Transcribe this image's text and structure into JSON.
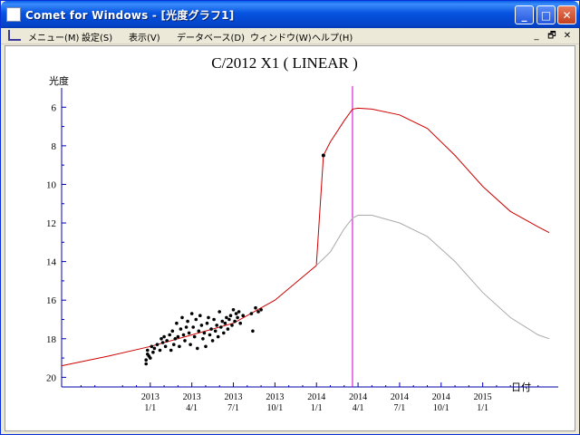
{
  "window": {
    "title": "Comet for Windows - [光度グラフ1]",
    "buttons": {
      "minimize": "_",
      "maximize": "□",
      "close": "✕"
    }
  },
  "menubar": {
    "items": [
      "メニュー(M)",
      "設定(S)",
      "表示(V)",
      "データベース(D)",
      "ウィンドウ(W)",
      "ヘルプ(H)"
    ],
    "mdi_buttons": [
      "_",
      "🗗",
      "✕"
    ]
  },
  "colors": {
    "accent": "#0054e3",
    "observed_curve": "#cc0000",
    "secondary_curve": "#aaaaaa",
    "perihelion_line": "#cc00cc",
    "axis": "#0000aa"
  },
  "chart_data": {
    "type": "scatter",
    "title": "C/2012 X1 ( LINEAR )",
    "ylabel": "光度",
    "xlabel": "日付",
    "y_inverted": true,
    "ylim": [
      20.5,
      5
    ],
    "y_ticks": [
      6,
      8,
      10,
      12,
      14,
      16,
      18,
      20
    ],
    "x_ticks": [
      {
        "year": "2013",
        "md": "1/1"
      },
      {
        "year": "2013",
        "md": "4/1"
      },
      {
        "year": "2013",
        "md": "7/1"
      },
      {
        "year": "2013",
        "md": "10/1"
      },
      {
        "year": "2014",
        "md": "1/1"
      },
      {
        "year": "2014",
        "md": "4/1"
      },
      {
        "year": "2014",
        "md": "7/1"
      },
      {
        "year": "2014",
        "md": "10/1"
      },
      {
        "year": "2015",
        "md": "1/1"
      }
    ],
    "xlim_months": [
      -6.4,
      28.8
    ],
    "perihelion_month": 14.6,
    "series": [
      {
        "kind": "line",
        "points": [
          [
            -6.4,
            19.4
          ],
          [
            -3,
            18.9
          ],
          [
            0,
            18.4
          ],
          [
            3,
            17.8
          ],
          [
            6,
            17.2
          ],
          [
            9,
            16.0
          ],
          [
            12,
            14.2
          ],
          [
            12.0,
            14.1
          ],
          [
            12.5,
            8.5
          ],
          [
            13,
            7.8
          ],
          [
            14,
            6.7
          ],
          [
            14.6,
            6.1
          ],
          [
            15,
            6.05
          ],
          [
            16,
            6.1
          ],
          [
            18,
            6.4
          ],
          [
            20,
            7.1
          ],
          [
            22,
            8.5
          ],
          [
            24,
            10.1
          ],
          [
            26,
            11.4
          ],
          [
            28,
            12.2
          ],
          [
            28.8,
            12.5
          ]
        ]
      },
      {
        "kind": "line",
        "points": [
          [
            12,
            14.2
          ],
          [
            13,
            13.5
          ],
          [
            14,
            12.3
          ],
          [
            14.6,
            11.75
          ],
          [
            15,
            11.6
          ],
          [
            16,
            11.6
          ],
          [
            18,
            12.0
          ],
          [
            20,
            12.7
          ],
          [
            22,
            14.0
          ],
          [
            24,
            15.6
          ],
          [
            26,
            16.9
          ],
          [
            28,
            17.8
          ],
          [
            28.8,
            18.0
          ]
        ]
      }
    ],
    "observations": [
      [
        -0.3,
        19.3
      ],
      [
        -0.3,
        19.1
      ],
      [
        -0.2,
        18.8
      ],
      [
        -0.2,
        18.6
      ],
      [
        -0.1,
        18.9
      ],
      [
        0.0,
        19.0
      ],
      [
        0.1,
        18.4
      ],
      [
        0.2,
        18.7
      ],
      [
        0.3,
        18.5
      ],
      [
        0.5,
        18.3
      ],
      [
        0.7,
        18.6
      ],
      [
        0.8,
        18.0
      ],
      [
        0.9,
        18.2
      ],
      [
        1.0,
        17.9
      ],
      [
        1.1,
        18.4
      ],
      [
        1.2,
        18.1
      ],
      [
        1.4,
        17.8
      ],
      [
        1.5,
        18.6
      ],
      [
        1.6,
        17.6
      ],
      [
        1.7,
        18.3
      ],
      [
        1.8,
        18.0
      ],
      [
        1.9,
        17.2
      ],
      [
        2.0,
        17.9
      ],
      [
        2.1,
        18.4
      ],
      [
        2.2,
        17.5
      ],
      [
        2.3,
        16.9
      ],
      [
        2.4,
        17.8
      ],
      [
        2.5,
        18.1
      ],
      [
        2.6,
        17.4
      ],
      [
        2.7,
        17.1
      ],
      [
        2.8,
        17.7
      ],
      [
        2.9,
        18.3
      ],
      [
        3.0,
        16.7
      ],
      [
        3.1,
        17.4
      ],
      [
        3.2,
        17.9
      ],
      [
        3.3,
        17.0
      ],
      [
        3.4,
        18.5
      ],
      [
        3.5,
        17.6
      ],
      [
        3.6,
        16.8
      ],
      [
        3.7,
        17.3
      ],
      [
        3.8,
        18.0
      ],
      [
        3.9,
        17.7
      ],
      [
        4.0,
        18.4
      ],
      [
        4.1,
        17.2
      ],
      [
        4.2,
        16.9
      ],
      [
        4.3,
        17.8
      ],
      [
        4.4,
        17.5
      ],
      [
        4.5,
        18.1
      ],
      [
        4.6,
        17.0
      ],
      [
        4.7,
        17.6
      ],
      [
        4.8,
        17.3
      ],
      [
        4.9,
        17.9
      ],
      [
        5.0,
        16.6
      ],
      [
        5.1,
        17.4
      ],
      [
        5.2,
        17.1
      ],
      [
        5.3,
        17.7
      ],
      [
        5.4,
        17.2
      ],
      [
        5.5,
        16.9
      ],
      [
        5.6,
        17.5
      ],
      [
        5.7,
        17.0
      ],
      [
        5.8,
        16.8
      ],
      [
        5.9,
        17.3
      ],
      [
        6.0,
        16.5
      ],
      [
        6.1,
        17.1
      ],
      [
        6.2,
        16.7
      ],
      [
        6.3,
        16.9
      ],
      [
        6.4,
        16.6
      ],
      [
        6.5,
        17.2
      ],
      [
        6.7,
        16.8
      ],
      [
        7.3,
        16.7
      ],
      [
        7.6,
        16.4
      ],
      [
        7.8,
        16.6
      ],
      [
        8.0,
        16.5
      ],
      [
        7.4,
        17.6
      ]
    ],
    "highlight_point": [
      12.5,
      8.5
    ]
  }
}
